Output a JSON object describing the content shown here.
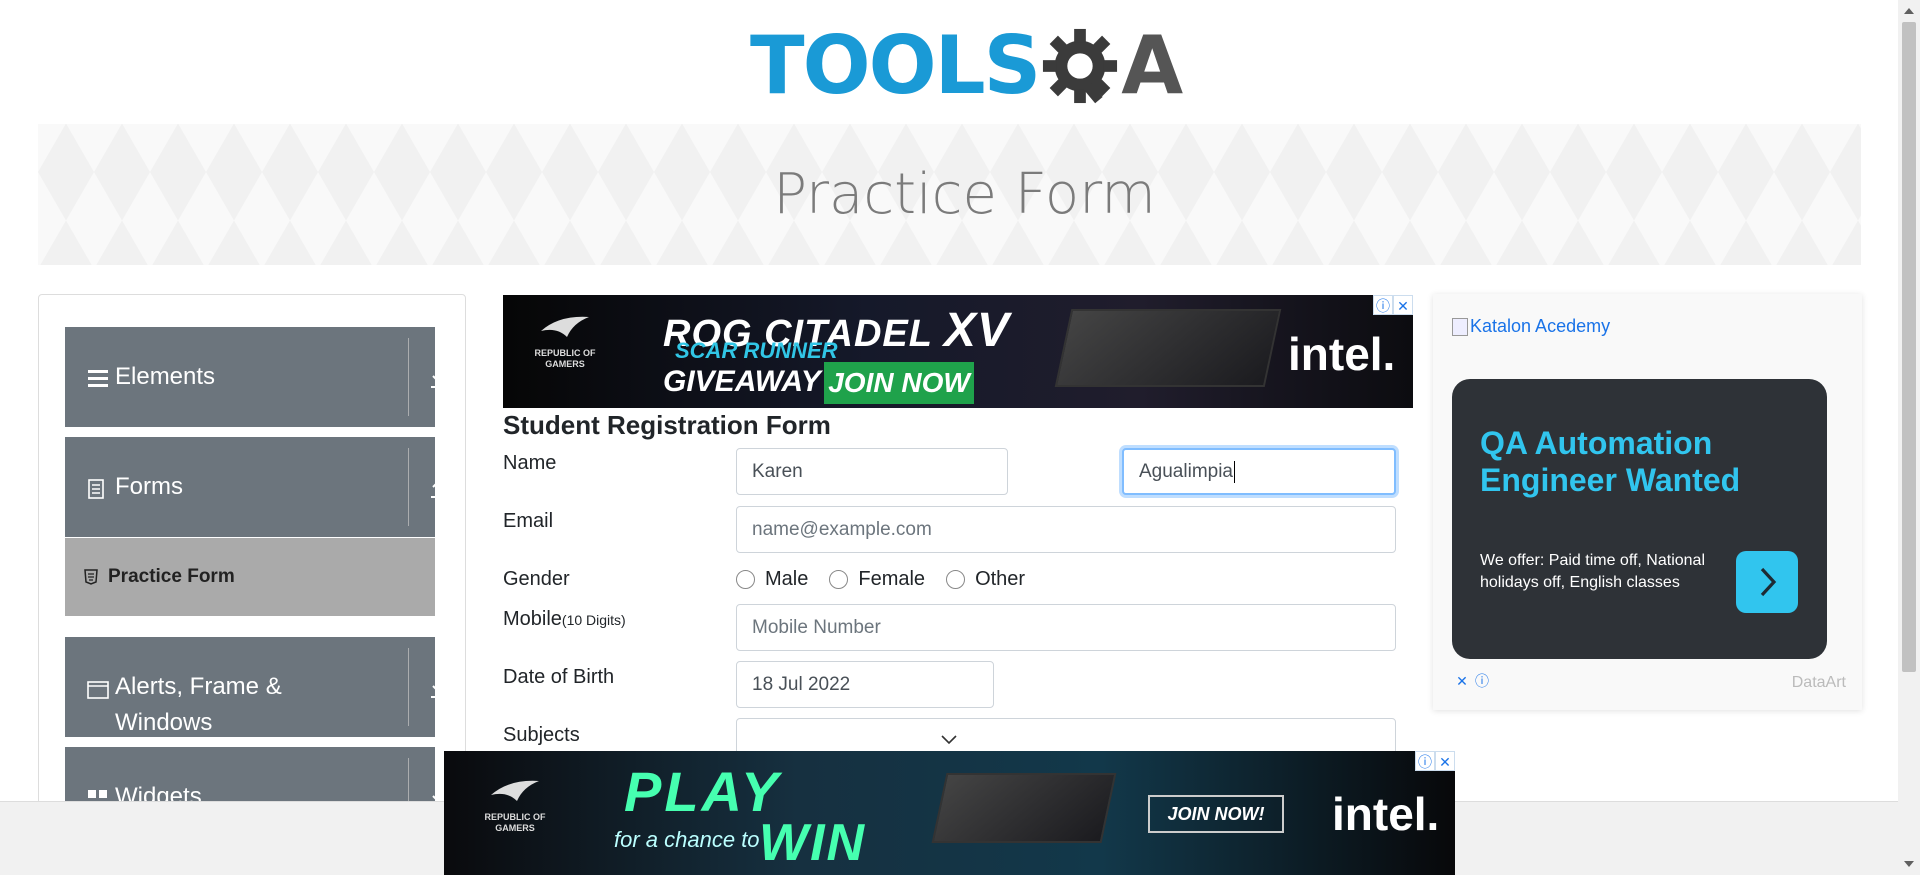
{
  "logo": {
    "tools": "TOOLS",
    "qa": "A"
  },
  "banner": {
    "title": "Practice Form"
  },
  "sidebar": {
    "groups": [
      {
        "label": "Elements",
        "expanded": false
      },
      {
        "label": "Forms",
        "expanded": true
      },
      {
        "label": "Alerts, Frame &",
        "label2": "Windows",
        "expanded": false
      },
      {
        "label": "Widgets",
        "expanded": false
      }
    ],
    "active_item": "Practice Form"
  },
  "ad_top": {
    "title": "ROG CITADEL",
    "title_xv": "XV",
    "subtitle": "SCAR RUNNER",
    "giveaway": "GIVEAWAY",
    "join": "JOIN NOW",
    "rog": "REPUBLIC OF GAMERS",
    "brand": "intel."
  },
  "ad_bottom": {
    "play": "PLAY",
    "chance": "for a chance to",
    "win": "WIN",
    "join": "JOIN NOW!",
    "rog": "REPUBLIC OF GAMERS",
    "brand": "intel."
  },
  "form": {
    "title": "Student Registration Form",
    "name_label": "Name",
    "first_name": "Karen",
    "last_name": "Agualimpia",
    "email_label": "Email",
    "email_placeholder": "name@example.com",
    "gender_label": "Gender",
    "gender_options": [
      "Male",
      "Female",
      "Other"
    ],
    "mobile_label": "Mobile",
    "mobile_hint": "(10 Digits)",
    "mobile_placeholder": "Mobile Number",
    "dob_label": "Date of Birth",
    "dob_value": "18 Jul 2022",
    "subjects_label": "Subjects"
  },
  "right_ad": {
    "broken_image_alt": "Katalon Acedemy",
    "headline": "QA Automation Engineer Wanted",
    "description": "We offer: Paid time off, National holidays off, English classes",
    "brand": "DataArt"
  },
  "colors": {
    "accent": "#1a9ad6",
    "sidebar": "#6c757d",
    "active": "#aaaaaa",
    "cyan": "#31c5ee"
  }
}
